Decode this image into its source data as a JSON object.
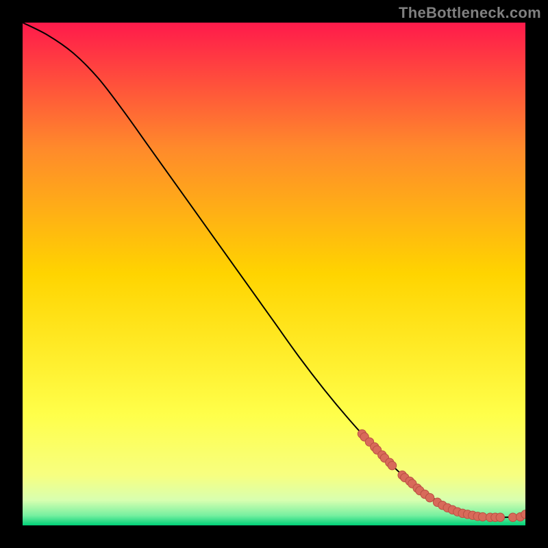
{
  "watermark": "TheBottleneck.com",
  "colors": {
    "gradient_top": "#ff1a4b",
    "gradient_q1": "#ff8a2b",
    "gradient_mid": "#ffd400",
    "gradient_q3": "#ffff4a",
    "gradient_low1": "#f7ff80",
    "gradient_low2": "#d8ffb0",
    "gradient_bottom1": "#78f0a0",
    "gradient_bottom2": "#00d078",
    "curve": "#000000",
    "marker_fill": "#d86a5a",
    "marker_stroke": "#b94f42",
    "frame": "#000000"
  },
  "chart_data": {
    "type": "line",
    "title": "",
    "xlabel": "",
    "ylabel": "",
    "xlim": [
      0,
      100
    ],
    "ylim": [
      0,
      100
    ],
    "series": [
      {
        "name": "bottleneck-curve",
        "x": [
          0,
          5,
          10,
          15,
          20,
          25,
          30,
          35,
          40,
          45,
          50,
          55,
          60,
          65,
          70,
          75,
          80,
          85,
          88,
          90,
          92,
          95,
          98,
          100
        ],
        "y": [
          100,
          97.5,
          94,
          89,
          82.5,
          75.5,
          68.5,
          61.5,
          54.5,
          47.5,
          40.5,
          33.5,
          27,
          21,
          15.5,
          10.5,
          6.5,
          3.5,
          2.2,
          1.7,
          1.6,
          1.6,
          1.7,
          2.0
        ]
      }
    ],
    "markers": {
      "name": "highlighted-points",
      "x": [
        67.5,
        68.0,
        69.0,
        70.0,
        70.5,
        71.5,
        72.0,
        73.0,
        73.5,
        75.5,
        76.0,
        77.0,
        77.5,
        78.5,
        79.0,
        80.0,
        81.0,
        82.5,
        83.5,
        84.5,
        85.5,
        86.5,
        87.5,
        88.5,
        89.5,
        90.5,
        91.5,
        93.0,
        94.0,
        95.0,
        97.5,
        99.0,
        100.0
      ],
      "y": [
        18.2,
        17.6,
        16.6,
        15.6,
        15.0,
        14.0,
        13.4,
        12.5,
        11.9,
        10.0,
        9.5,
        8.8,
        8.3,
        7.4,
        6.9,
        6.2,
        5.5,
        4.6,
        4.0,
        3.5,
        3.1,
        2.7,
        2.4,
        2.2,
        2.0,
        1.8,
        1.7,
        1.6,
        1.6,
        1.6,
        1.6,
        1.7,
        2.2
      ]
    }
  }
}
